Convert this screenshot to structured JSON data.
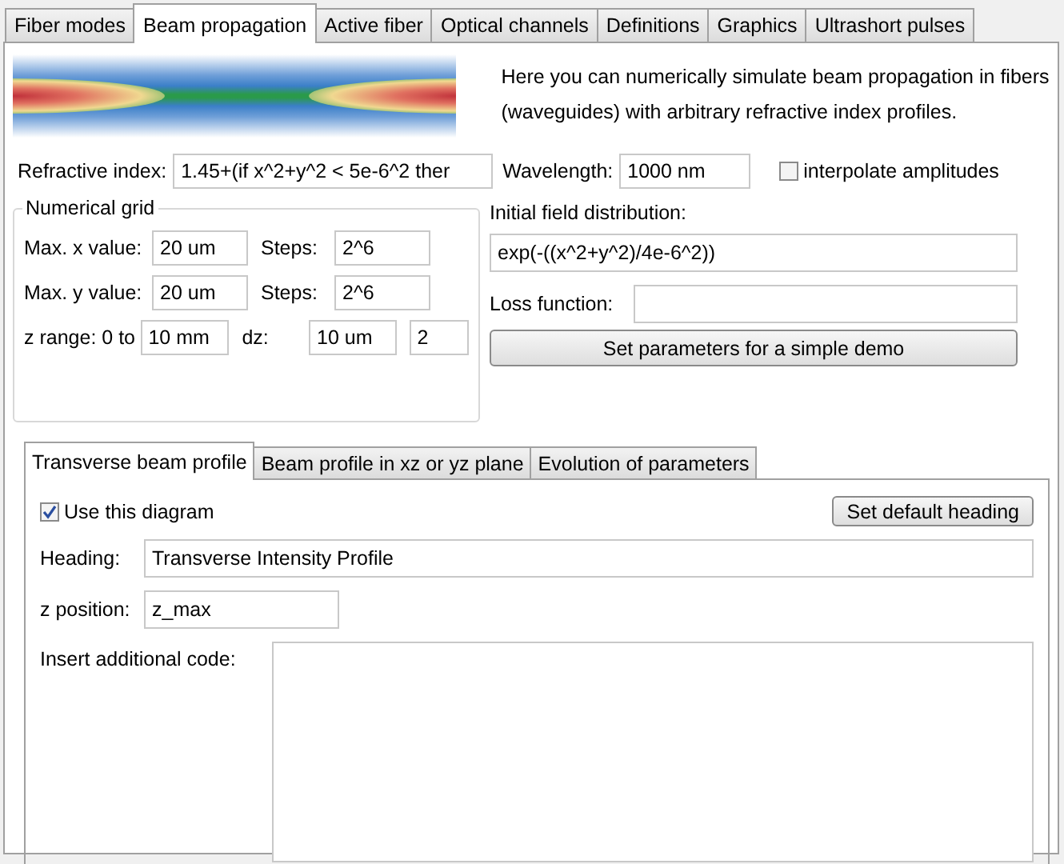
{
  "tabs": [
    {
      "label": "Fiber modes",
      "selected": false
    },
    {
      "label": "Beam propagation",
      "selected": true
    },
    {
      "label": "Active fiber",
      "selected": false
    },
    {
      "label": "Optical channels",
      "selected": false
    },
    {
      "label": "Definitions",
      "selected": false
    },
    {
      "label": "Graphics",
      "selected": false
    },
    {
      "label": "Ultrashort pulses",
      "selected": false
    }
  ],
  "intro": "Here you can numerically simulate beam propagation in fibers (waveguides) with arbitrary refractive index profiles.",
  "refractive_index": {
    "label": "Refractive index:",
    "value": "1.45+(if x^2+y^2 < 5e-6^2 ther"
  },
  "wavelength": {
    "label": "Wavelength:",
    "value": "1000 nm"
  },
  "interpolate": {
    "label": "interpolate amplitudes",
    "checked": false
  },
  "numerical_grid": {
    "title": "Numerical grid",
    "rows": [
      {
        "fields": [
          {
            "label": "Max. x value:",
            "value": "20 um"
          },
          {
            "label": "Steps:",
            "value": "2^6"
          }
        ]
      },
      {
        "fields": [
          {
            "label": "Max. y value:",
            "value": "20 um"
          },
          {
            "label": "Steps:",
            "value": "2^6"
          }
        ]
      },
      {
        "fields": [
          {
            "label": "z range: 0 to",
            "value": "10 mm"
          },
          {
            "label": "dz:",
            "value": "10 um"
          },
          {
            "value": "2"
          }
        ]
      }
    ]
  },
  "initial_field": {
    "label": "Initial field distribution:",
    "value": "exp(-((x^2+y^2)/4e-6^2))"
  },
  "loss_function": {
    "label": "Loss function:"
  },
  "demo_button": "Set parameters for a simple demo",
  "subtabs": [
    {
      "label": "Transverse beam profile",
      "selected": true
    },
    {
      "label": "Beam profile in xz or yz plane",
      "selected": false
    },
    {
      "label": "Evolution of parameters",
      "selected": false
    }
  ],
  "use_diagram": {
    "label": "Use this diagram",
    "checked": true
  },
  "default_heading_button": "Set default heading",
  "heading": {
    "label": "Heading:",
    "value": "Transverse Intensity Profile"
  },
  "z_position": {
    "label": "z position:",
    "value": "z_max"
  },
  "additional_code": {
    "label": "Insert additional code:"
  }
}
